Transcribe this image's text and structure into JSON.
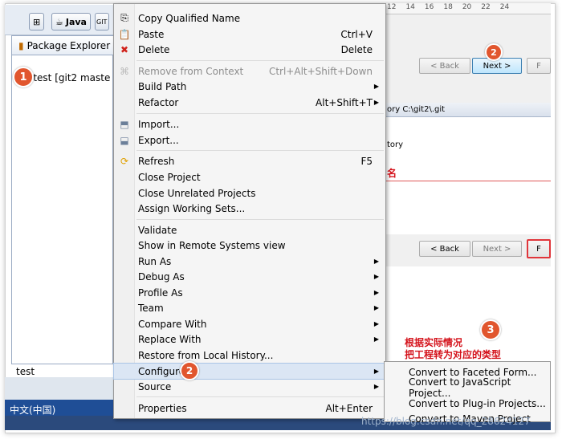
{
  "toolbar": {
    "java_label": "Java",
    "git_label": "GIT"
  },
  "package_explorer": {
    "tab_label": "Package Explorer",
    "project_label": "test [git2 maste",
    "status_text": "test",
    "language_label": "中文(中国)"
  },
  "badges": {
    "b1": "1",
    "b2": "2",
    "b3": "3"
  },
  "ruler_labels": [
    "12",
    "14",
    "16",
    "18",
    "20",
    "22",
    "24"
  ],
  "wizard": {
    "back_label": "< Back",
    "next_label": "Next >",
    "finish_label": "F",
    "repo_text": "ory C:\\git2\\.git",
    "repo_text2": "tory",
    "red_label": "名",
    "back2_label": "< Back",
    "next2_label": "Next >",
    "finish2_label": "F"
  },
  "menu": {
    "copy_qualified": "Copy Qualified Name",
    "paste": "Paste",
    "paste_acc": "Ctrl+V",
    "delete": "Delete",
    "delete_acc": "Delete",
    "remove_ctx": "Remove from Context",
    "remove_ctx_acc": "Ctrl+Alt+Shift+Down",
    "build_path": "Build Path",
    "refactor": "Refactor",
    "refactor_acc": "Alt+Shift+T",
    "import": "Import...",
    "export": "Export...",
    "refresh": "Refresh",
    "refresh_acc": "F5",
    "close_project": "Close Project",
    "close_unrelated": "Close Unrelated Projects",
    "assign_ws": "Assign Working Sets...",
    "validate": "Validate",
    "show_remote": "Show in Remote Systems view",
    "run_as": "Run As",
    "debug_as": "Debug As",
    "profile_as": "Profile As",
    "team": "Team",
    "compare_with": "Compare With",
    "replace_with": "Replace With",
    "restore_history": "Restore from Local History...",
    "configure": "Configure",
    "source": "Source",
    "properties": "Properties",
    "properties_acc": "Alt+Enter"
  },
  "submenu": {
    "faceted": "Convert to Faceted Form...",
    "javascript": "Convert to JavaScript Project...",
    "plugin": "Convert to Plug-in Projects...",
    "maven": "Convert to Maven Project"
  },
  "annotation": {
    "line1": "根据实际情况",
    "line2": "把工程转为对应的类型"
  },
  "watermark": "https://blog.csdn.net/qq_28624127",
  "colors": {
    "badge": "#e1562e",
    "highlight": "#dbe6f4",
    "annotation": "#d4111a"
  }
}
